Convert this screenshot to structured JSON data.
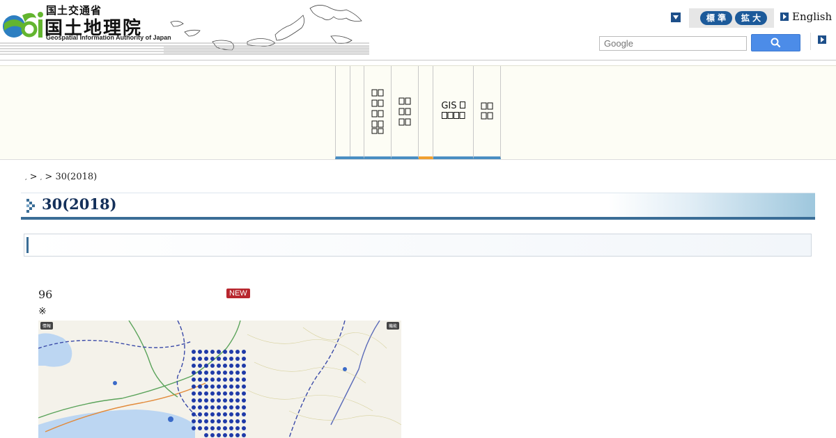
{
  "header": {
    "logo": {
      "ministry": "国土交通省",
      "title": "国土地理院",
      "subtitle": "Geospatial Information Authority of Japan"
    },
    "text_size": {
      "standard_label": "標 準",
      "large_label": "拡 大"
    },
    "english_link": "English",
    "search": {
      "placeholder": "Google"
    }
  },
  "nav": {
    "items": [
      {
        "label": ""
      },
      {
        "label": ""
      },
      {
        "label": "\n\n\n\n"
      },
      {
        "label": "\n\n"
      },
      {
        "label": ""
      },
      {
        "label": "GIS\n"
      },
      {
        "label": "\n"
      }
    ]
  },
  "breadcrumb": {
    "sep1": " > ",
    "sep2": " > ",
    "current": "30(2018)"
  },
  "page": {
    "title": "30(2018)",
    "count": "96",
    "new_badge": "NEW",
    "note": "※"
  },
  "map": {
    "label_left": "情報",
    "label_right": "機能"
  },
  "colors": {
    "nav_accent": "#4a8ec2",
    "nav_active": "#f0a030",
    "title_border": "#3a6d96",
    "search_button": "#4c8ce8",
    "size_button": "#1c5a9a",
    "new_badge": "#b8262e"
  }
}
